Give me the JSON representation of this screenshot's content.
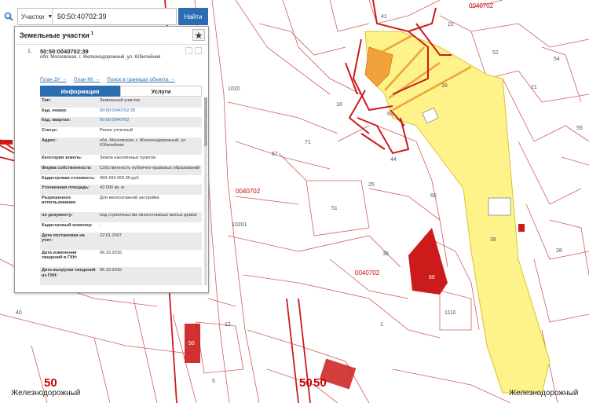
{
  "search": {
    "type_label": "Участки",
    "query": "50:50:40702:39",
    "find_label": "Найти"
  },
  "panel": {
    "title": "Земельные участки",
    "title_count": "1",
    "result": {
      "number": "1.",
      "cad_id": "50:50:0040702:39",
      "address": "обл. Московская, г. Железнодорожный, ул. Юбилейная"
    },
    "links": [
      "План ЗУ →",
      "План КК →",
      "Поиск в границах объекта →"
    ],
    "tabs": [
      "Информация",
      "Услуги"
    ],
    "rows": [
      {
        "k": "Тип:",
        "v": "Земельный участок",
        "link": false
      },
      {
        "k": "Кад. номер:",
        "v": "50:50:0040702:39",
        "link": true
      },
      {
        "k": "Кад. квартал:",
        "v": "50:50:0040702",
        "link": true
      },
      {
        "k": "Статус:",
        "v": "Ранее учтенный",
        "link": false
      },
      {
        "k": "Адрес:",
        "v": "обл. Московская, г. Железнодорожный, ул. Юбилейная",
        "link": false
      },
      {
        "k": "Категория земель:",
        "v": "Земли населённых пунктов",
        "link": false
      },
      {
        "k": "Форма собственности:",
        "v": "Собственность публично-правовых образований",
        "link": false
      },
      {
        "k": "Кадастровая стоимость:",
        "v": "469 434 260,00 руб.",
        "link": false
      },
      {
        "k": "Уточненная площадь:",
        "v": "43 000 кв. м",
        "link": false
      },
      {
        "k": "Разрешенное использование:",
        "v": "Для многоэтажной застройки",
        "link": false
      },
      {
        "k": "по документу:",
        "v": "под строительство многоэтажных жилых домов",
        "link": false
      },
      {
        "k": "Кадастровый инженер:",
        "v": "-",
        "link": false
      },
      {
        "k": "Дата постановки на учет:",
        "v": "22.01.2007",
        "link": false
      },
      {
        "k": "Дата изменения сведений в ГКН:",
        "v": "06.10.2016",
        "link": false
      },
      {
        "k": "Дата выгрузки сведений из ГКН:",
        "v": "06.10.2016",
        "link": false
      }
    ]
  },
  "map": {
    "labels": {
      "quarter_top": "0040702",
      "quarter_mid1": "0040702",
      "quarter_mid2": "0040702",
      "n41": "41",
      "n22": "22",
      "n52": "52",
      "n21": "21",
      "n39a": "39",
      "n39b": "39",
      "n18": "18",
      "n60a": "60",
      "n71": "71",
      "n67": "67",
      "n44": "44",
      "n25": "25",
      "n60b": "60",
      "n51": "51",
      "n38": "38",
      "n60c": "60",
      "n1110": "1110",
      "n12": "12",
      "n5": "5",
      "n1": "1",
      "n50s": "50",
      "n1020": "1020",
      "n10201": "10201",
      "n40": "40",
      "n54": "54",
      "n55": "55",
      "n28": "28"
    },
    "big50_left": "50",
    "big50_mid": "50",
    "big50_mid2": "50",
    "city_left": "Железнодорожный",
    "city_right": "Железнодорожный",
    "colors": {
      "red": "#cc1b1b",
      "yellow": "#fdf38a",
      "orange": "#f2a23a",
      "accent": "#2b6db0"
    }
  }
}
